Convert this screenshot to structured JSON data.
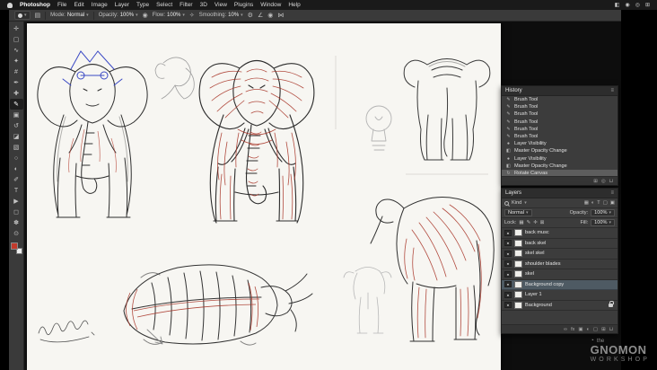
{
  "menu_bar": {
    "app_name": "Photoshop",
    "items": [
      "File",
      "Edit",
      "Image",
      "Layer",
      "Type",
      "Select",
      "Filter",
      "3D",
      "View",
      "Plugins",
      "Window",
      "Help"
    ],
    "extras": [
      {
        "name": "battery-icon",
        "glyph": "◧"
      },
      {
        "name": "wifi-icon",
        "glyph": "◉"
      },
      {
        "name": "spotlight-search-icon",
        "glyph": "◎"
      },
      {
        "name": "control-center-icon",
        "glyph": "⊞"
      }
    ]
  },
  "options_bar": {
    "caret_glyph": "▾",
    "mode_label": "Mode:",
    "mode_value": "Normal",
    "opacity_label": "Opacity:",
    "opacity_value": "100%",
    "flow_label": "Flow:",
    "flow_value": "100%",
    "smoothing_label": "Smoothing:",
    "smoothing_value": "10%",
    "icons": {
      "toggle": "▤",
      "pressure": "◉",
      "airbrush": "✧",
      "gear": "⚙",
      "angle": "∠",
      "pressure_size": "◉",
      "symmetry": "⋈"
    }
  },
  "tools": [
    {
      "name": "move-tool",
      "glyph": "✛"
    },
    {
      "name": "marquee-tool",
      "glyph": "▢"
    },
    {
      "name": "lasso-tool",
      "glyph": "∿"
    },
    {
      "name": "magic-wand-tool",
      "glyph": "✦"
    },
    {
      "name": "crop-tool",
      "glyph": "#"
    },
    {
      "name": "eyedropper-tool",
      "glyph": "✒"
    },
    {
      "name": "healing-tool",
      "glyph": "✚"
    },
    {
      "name": "brush-tool",
      "glyph": "✎"
    },
    {
      "name": "clone-stamp-tool",
      "glyph": "▣"
    },
    {
      "name": "history-brush-tool",
      "glyph": "↺"
    },
    {
      "name": "eraser-tool",
      "glyph": "◪"
    },
    {
      "name": "gradient-tool",
      "glyph": "▧"
    },
    {
      "name": "blur-tool",
      "glyph": "○"
    },
    {
      "name": "dodge-tool",
      "glyph": "◐"
    },
    {
      "name": "pen-tool",
      "glyph": "✐"
    },
    {
      "name": "type-tool",
      "glyph": "T"
    },
    {
      "name": "path-select-tool",
      "glyph": "▶"
    },
    {
      "name": "shape-tool",
      "glyph": "◻"
    },
    {
      "name": "hand-tool",
      "glyph": "✽"
    },
    {
      "name": "zoom-tool",
      "glyph": "⊙"
    }
  ],
  "colors": {
    "foreground_swatch": "#c13a2c",
    "background_swatch": "#ededed",
    "fg_style": "background:#c13a2c",
    "bg_style": "background:#ededed"
  },
  "history": {
    "title": "History",
    "items": [
      {
        "glyph": "✎",
        "label": "Brush Tool"
      },
      {
        "glyph": "✎",
        "label": "Brush Tool"
      },
      {
        "glyph": "✎",
        "label": "Brush Tool"
      },
      {
        "glyph": "✎",
        "label": "Brush Tool"
      },
      {
        "glyph": "✎",
        "label": "Brush Tool"
      },
      {
        "glyph": "✎",
        "label": "Brush Tool"
      },
      {
        "glyph": "●",
        "label": "Layer Visibility"
      },
      {
        "glyph": "◧",
        "label": "Master Opacity Change"
      },
      {
        "glyph": "●",
        "label": "Layer Visibility"
      },
      {
        "glyph": "◧",
        "label": "Master Opacity Change"
      },
      {
        "glyph": "↻",
        "label": "Rotate Canvas",
        "selected": true
      }
    ],
    "footer": [
      {
        "name": "new-document-from-state-icon",
        "glyph": "⊞"
      },
      {
        "name": "new-snapshot-icon",
        "glyph": "◎"
      },
      {
        "name": "delete-state-icon",
        "glyph": "⊔"
      }
    ]
  },
  "layers": {
    "title": "Layers",
    "kind_label": "Kind",
    "blend_mode": "Normal",
    "opacity_label": "Opacity:",
    "opacity_value": "100%",
    "lock_label": "Lock:",
    "fill_label": "Fill:",
    "fill_value": "100%",
    "eye_glyph": "●",
    "filter_icons": [
      {
        "name": "filter-pixel-layers-icon",
        "glyph": "▦"
      },
      {
        "name": "filter-adjustment-layers-icon",
        "glyph": "◐"
      },
      {
        "name": "filter-type-layers-icon",
        "glyph": "T"
      },
      {
        "name": "filter-shape-layers-icon",
        "glyph": "▢"
      },
      {
        "name": "filter-smart-objects-icon",
        "glyph": "▣"
      }
    ],
    "lock_icons": [
      {
        "name": "lock-transparency-icon",
        "glyph": "▦"
      },
      {
        "name": "lock-pixels-icon",
        "glyph": "✎"
      },
      {
        "name": "lock-position-icon",
        "glyph": "✛"
      },
      {
        "name": "lock-all-icon",
        "glyph": "⊠"
      }
    ],
    "items": [
      {
        "name": "back musc"
      },
      {
        "name": "back skel"
      },
      {
        "name": "skel skel"
      },
      {
        "name": "shoulder blades"
      },
      {
        "name": "skel"
      },
      {
        "name": "Background copy",
        "selected": true
      },
      {
        "name": "Layer 1"
      },
      {
        "name": "Background",
        "locked": true
      }
    ],
    "footer": [
      {
        "name": "link-layers-icon",
        "glyph": "∞"
      },
      {
        "name": "layer-effects-icon",
        "glyph": "fx"
      },
      {
        "name": "layer-mask-icon",
        "glyph": "▣"
      },
      {
        "name": "adjustment-layer-icon",
        "glyph": "◐"
      },
      {
        "name": "layer-group-icon",
        "glyph": "▢"
      },
      {
        "name": "new-layer-icon",
        "glyph": "⊞"
      },
      {
        "name": "delete-layer-icon",
        "glyph": "⊔"
      }
    ]
  },
  "watermark": {
    "mark_glyph": "◔",
    "pre": "the",
    "title": "GNOMON",
    "subtitle": "WORKSHOP"
  }
}
